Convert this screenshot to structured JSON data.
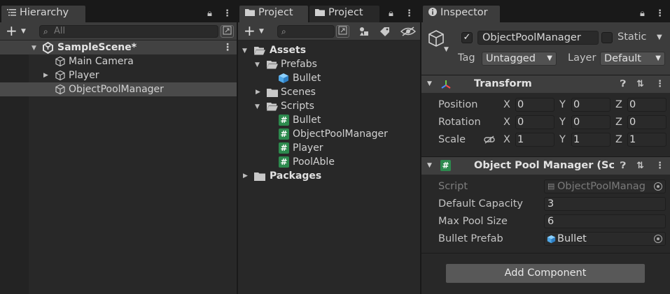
{
  "hierarchy": {
    "tab_label": "Hierarchy",
    "search_placeholder": "All",
    "scene_name": "SampleScene*",
    "items": [
      {
        "label": "Main Camera"
      },
      {
        "label": "Player"
      },
      {
        "label": "ObjectPoolManager"
      }
    ]
  },
  "project": {
    "tab_label": "Project",
    "tab2_label": "Project",
    "tree": {
      "assets": "Assets",
      "prefabs": "Prefabs",
      "bullet_prefab": "Bullet",
      "scenes": "Scenes",
      "scripts": "Scripts",
      "script_files": [
        "Bullet",
        "ObjectPoolManager",
        "Player",
        "PoolAble"
      ],
      "packages": "Packages"
    }
  },
  "inspector": {
    "tab_label": "Inspector",
    "object_name": "ObjectPoolManager",
    "active_checked": true,
    "static_label": "Static",
    "tag_label": "Tag",
    "tag_value": "Untagged",
    "layer_label": "Layer",
    "layer_value": "Default",
    "transform": {
      "title": "Transform",
      "position_label": "Position",
      "rotation_label": "Rotation",
      "scale_label": "Scale",
      "axis_x": "X",
      "axis_y": "Y",
      "axis_z": "Z",
      "position": [
        "0",
        "0",
        "0"
      ],
      "rotation": [
        "0",
        "0",
        "0"
      ],
      "scale": [
        "1",
        "1",
        "1"
      ]
    },
    "pool_component": {
      "title": "Object Pool Manager (Scrip",
      "script_label": "Script",
      "script_value": "ObjectPoolManag",
      "default_capacity_label": "Default Capacity",
      "default_capacity_value": "3",
      "max_pool_size_label": "Max Pool Size",
      "max_pool_size_value": "6",
      "bullet_prefab_label": "Bullet Prefab",
      "bullet_prefab_value": "Bullet"
    },
    "add_component_label": "Add Component"
  },
  "colors": {
    "cs_script": "#2d8a4e",
    "prefab_blue": "#4fa8e8",
    "panel_bg": "#282828"
  }
}
